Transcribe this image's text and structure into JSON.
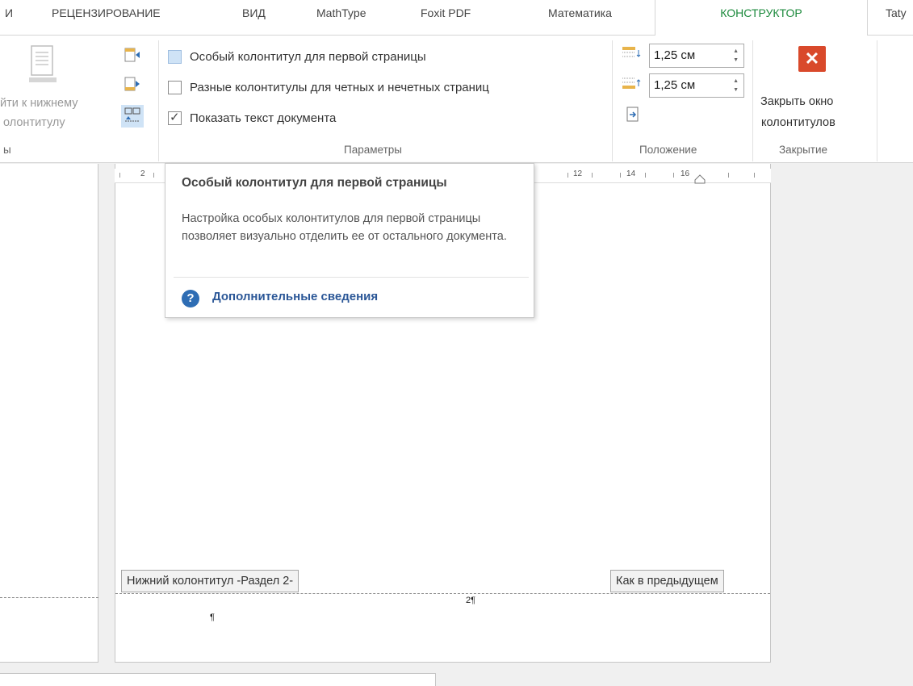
{
  "tabs": {
    "m": "И",
    "review": "РЕЦЕНЗИРОВАНИЕ",
    "view": "ВИД",
    "mathtype": "MathType",
    "foxit": "Foxit PDF",
    "math": "Математика",
    "constructor": "КОНСТРУКТОР",
    "user": "Taty"
  },
  "ribbon": {
    "nav_label_line1": "йти к нижнему",
    "nav_label_line2": "олонтитулу",
    "nav_group_label": "ы",
    "options": {
      "first_page": "Особый колонтитул для первой страницы",
      "odd_even": "Разные колонтитулы для четных и нечетных страниц",
      "show_text": "Показать текст документа",
      "group_label": "Параметры"
    },
    "position": {
      "header_distance": "1,25 см",
      "footer_distance": "1,25 см",
      "group_label": "Положение"
    },
    "close": {
      "label_line1": "Закрыть окно",
      "label_line2": "колонтитулов",
      "group_label": "Закрытие"
    },
    "accent_color": "#1c8a3c",
    "close_color": "#d9492b"
  },
  "ruler": {
    "n2": "2",
    "n12": "12",
    "n14": "14",
    "n16": "16"
  },
  "document": {
    "footer_label": "Нижний колонтитул -Раздел 2-",
    "same_as_previous": "Как в предыдущем",
    "page_number": "2¶",
    "pilcrow": "¶"
  },
  "tooltip": {
    "title": "Особый колонтитул для первой страницы",
    "body": "Настройка особых колонтитулов для первой страницы позволяет визуально отделить ее от остального документа.",
    "link": "Дополнительные сведения",
    "help_icon": "?"
  }
}
